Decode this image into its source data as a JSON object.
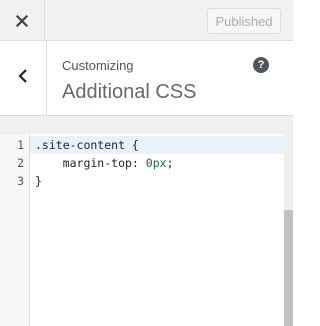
{
  "header": {
    "close_icon": "close-icon",
    "publish_label": "Published"
  },
  "section": {
    "back_icon": "chevron-left-icon",
    "eyebrow": "Customizing",
    "title": "Additional CSS",
    "help_icon": "question-icon",
    "help_glyph": "?"
  },
  "editor": {
    "lines": [
      {
        "number": "1",
        "text": ".site-content {",
        "active": true
      },
      {
        "number": "2",
        "prefix": "    margin-top: ",
        "value": "0px",
        "suffix": ";"
      },
      {
        "number": "3",
        "text": "}"
      }
    ]
  },
  "colors": {
    "active_line": "#e8f2ff",
    "value_token": "#116644",
    "header_bg": "#f1f1f1"
  }
}
